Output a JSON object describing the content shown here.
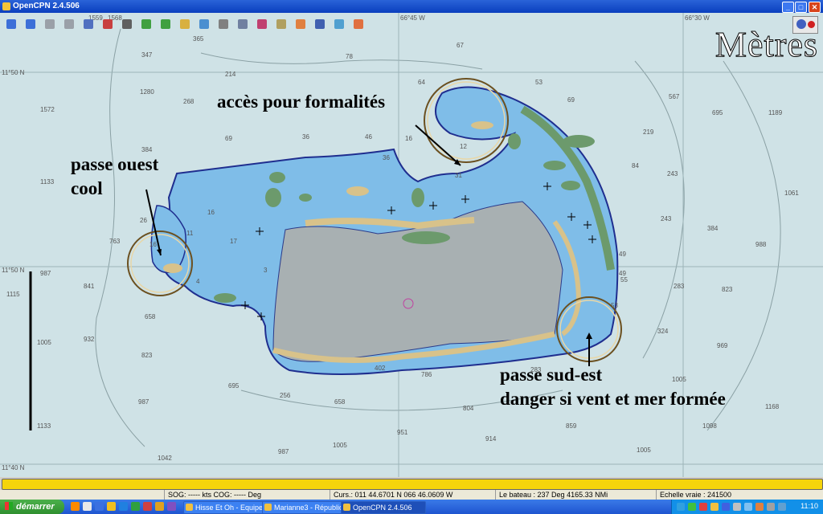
{
  "window": {
    "title": "OpenCPN 2.4.506"
  },
  "toolbar": {
    "tools": [
      {
        "name": "zoom-in-icon",
        "color": "#3c6fd8"
      },
      {
        "name": "zoom-out-icon",
        "color": "#3c6fd8"
      },
      {
        "name": "scale-in-icon",
        "color": "#9aa0a8"
      },
      {
        "name": "scale-out-icon",
        "color": "#9aa0a8"
      },
      {
        "name": "route-icon",
        "color": "#5070c0"
      },
      {
        "name": "ship-follow-icon",
        "color": "#c84040"
      },
      {
        "name": "measure-icon",
        "color": "#606060"
      },
      {
        "name": "text-icon",
        "color": "#40a040"
      },
      {
        "name": "current-icon",
        "color": "#40a040"
      },
      {
        "name": "tide-icon",
        "color": "#d8b040"
      },
      {
        "name": "chart-dbs-icon",
        "color": "#4a8fd0"
      },
      {
        "name": "print-icon",
        "color": "#808080"
      },
      {
        "name": "settings-icon",
        "color": "#7080a0"
      },
      {
        "name": "track-icon",
        "color": "#c04070"
      },
      {
        "name": "color-scheme-icon",
        "color": "#b0a060"
      },
      {
        "name": "mob-icon",
        "color": "#e08040"
      },
      {
        "name": "help-icon",
        "color": "#4060b0"
      },
      {
        "name": "quilt-icon",
        "color": "#50a0d0"
      },
      {
        "name": "ais-icon",
        "color": "#e07040"
      }
    ]
  },
  "chart": {
    "units_label": "Mètres",
    "coord_labels": [
      "11°50 N",
      "11°50 N",
      "11°40 N",
      "66°45 W",
      "66°30 W",
      "1559",
      "1568"
    ],
    "depths": [
      "365",
      "347",
      "78",
      "67",
      "64",
      "53",
      "69",
      "214",
      "1280",
      "268",
      "69",
      "36",
      "46",
      "1572",
      "384",
      "16",
      "36",
      "12",
      "31",
      "567",
      "219",
      "1189",
      "695",
      "84",
      "243",
      "1133",
      "1061",
      "49",
      "243",
      "763",
      "26",
      "16",
      "11",
      "16",
      "17",
      "384",
      "988",
      "1115",
      "987",
      "841",
      "4",
      "3",
      "283",
      "823",
      "49",
      "55",
      "53",
      "658",
      "932",
      "823",
      "1005",
      "324",
      "969",
      "402",
      "786",
      "283",
      "1005",
      "1168",
      "987",
      "695",
      "256",
      "658",
      "804",
      "914",
      "859",
      "1098",
      "1133",
      "1042",
      "987",
      "1005",
      "951",
      "1005"
    ],
    "annotations": {
      "access": "accès pour formalités",
      "west_pass_1": "passe ouest",
      "west_pass_2": "cool",
      "se_pass_1": "passe sud-est",
      "se_pass_2": "danger si vent et mer formée"
    }
  },
  "status": {
    "sog_cog": "SOG: ----- kts  COG: ----- Deg",
    "cursor": "Curs.: 011 44.6701 N 066 46.0609 W",
    "boat": "Le bateau : 237 Deg  4165.33 NMi",
    "scale": "Echelle vraie :  241500"
  },
  "taskbar": {
    "start_label": "démarrer",
    "tasks": [
      {
        "label": "Hisse Et Oh - Equipe...",
        "active": false
      },
      {
        "label": "Marianne3 - Républiq...",
        "active": false
      },
      {
        "label": "OpenCPN 2.4.506",
        "active": true
      }
    ],
    "clock": "11:10"
  }
}
